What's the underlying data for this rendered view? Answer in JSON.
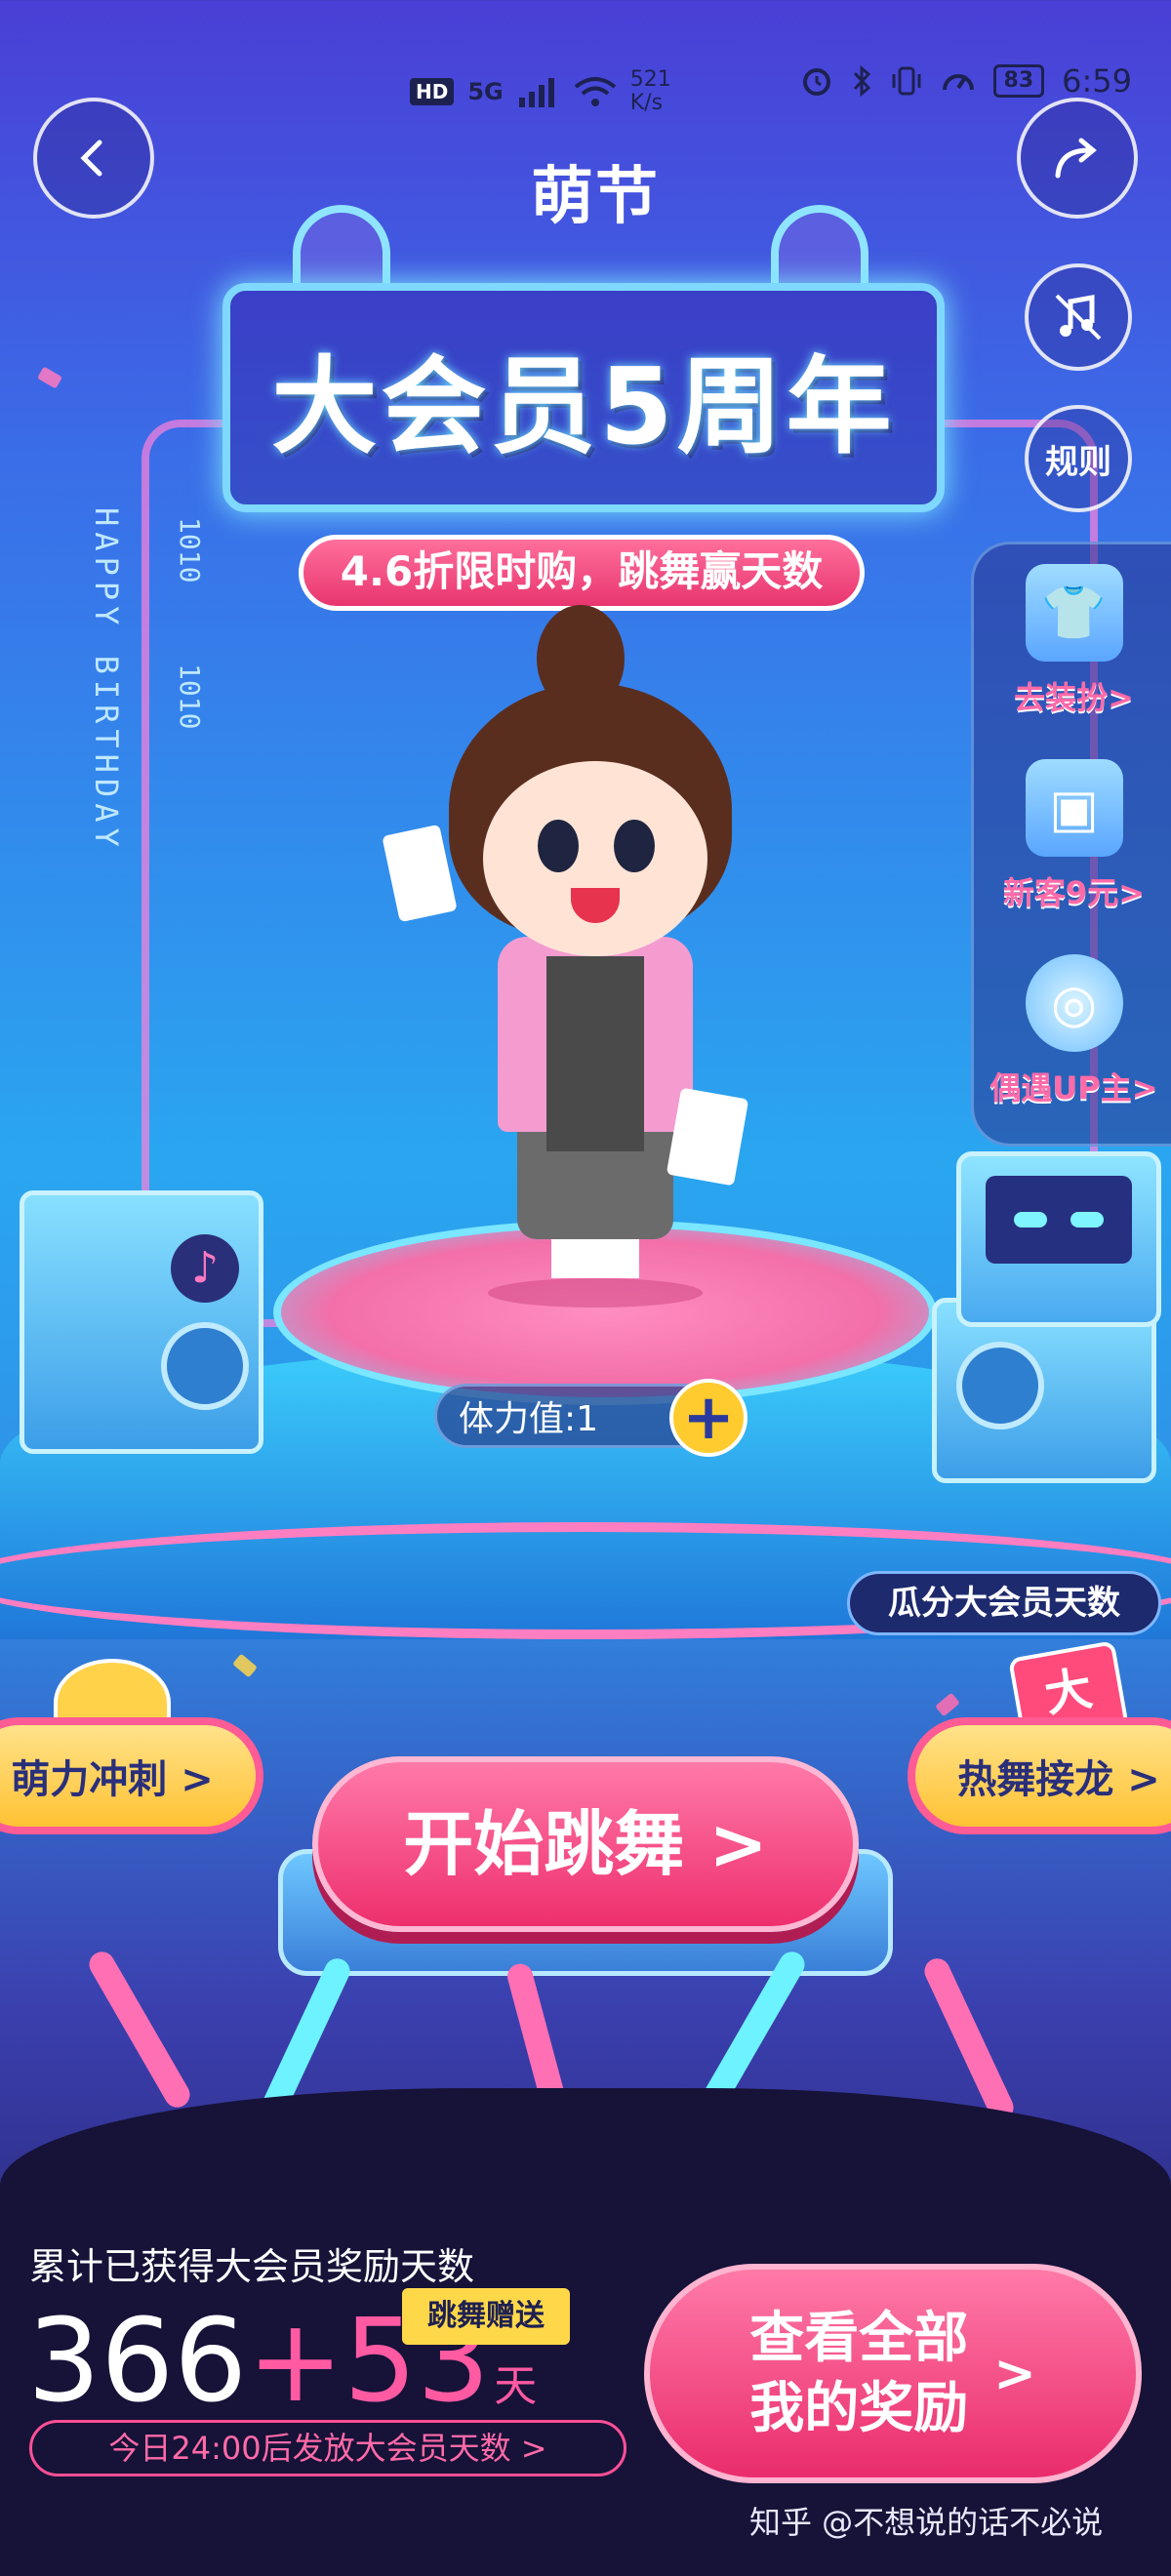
{
  "status_bar": {
    "left": [
      "HD",
      "5G",
      "521 K/s"
    ],
    "battery": "83",
    "time": "6:59"
  },
  "header": {
    "back_icon": "chevron-left-icon",
    "share_icon": "share-arrow-icon",
    "logo": "萌节"
  },
  "title": {
    "main": "大会员5周年",
    "subtitle": "4.6折限时购，跳舞赢天数",
    "side_text": "HAPPY BIRTHDAY",
    "side_num": "1010"
  },
  "side_controls": {
    "music_icon": "music-off-icon",
    "rules": "规则"
  },
  "side_panel": [
    {
      "label": "去装扮>",
      "icon": "tshirt-icon"
    },
    {
      "label": "新客9元>",
      "icon": "card-icon"
    },
    {
      "label": "偶遇UP主>",
      "icon": "magnifier-icon"
    }
  ],
  "stamina": {
    "label": "体力值:1",
    "plus": "+"
  },
  "split_tag": "瓜分大会员天数",
  "buttons": {
    "left": "萌力冲刺 >",
    "right": "热舞接龙 >",
    "start": "开始跳舞 >"
  },
  "bottom": {
    "total_label": "累计已获得大会员奖励天数",
    "base_days": "366",
    "bonus": "+53",
    "day_unit": "天",
    "dance_tag": "跳舞赠送",
    "release_text": "今日24:00后发放大会员天数 >",
    "view_line1": "查看全部",
    "view_line2": "我的奖励",
    "view_arrow": ">"
  },
  "watermark": "知乎 @不想说的话不必说",
  "colors": {
    "accent_pink": "#ee2f6e",
    "accent_yellow": "#ffc233",
    "panel_blue": "#1e2a6e"
  }
}
